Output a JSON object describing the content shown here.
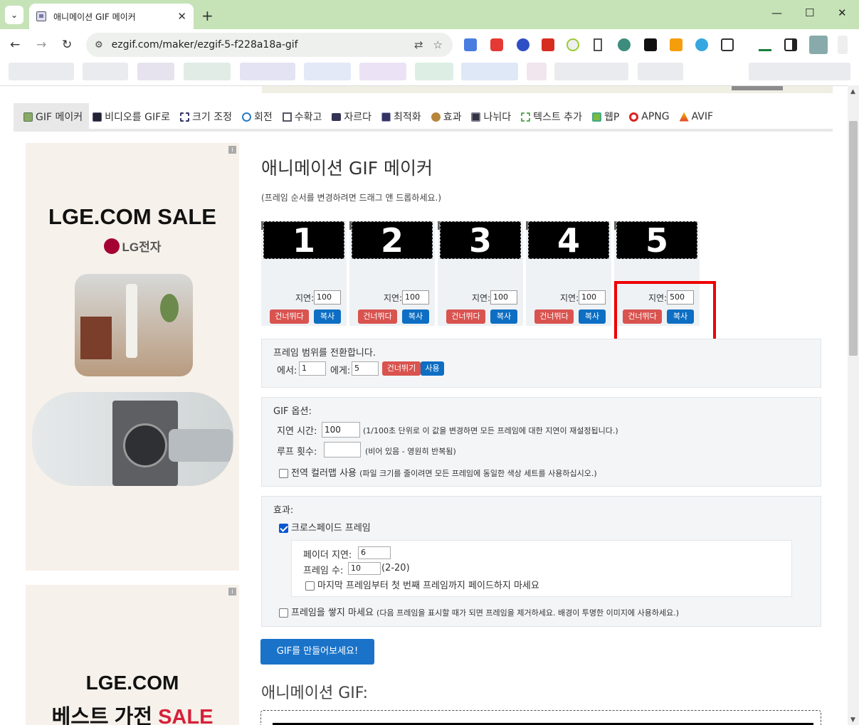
{
  "browser": {
    "tab_title": "애니메이션 GIF 메이커",
    "url": "ezgif.com/maker/ezgif-5-f228a18a-gif",
    "window_controls": [
      "minimize-icon",
      "maximize-icon",
      "close-icon"
    ]
  },
  "menu": {
    "items": [
      {
        "label": "GIF 메이커",
        "icon": "gif-maker-icon"
      },
      {
        "label": "비디오를 GIF로",
        "icon": "video-icon"
      },
      {
        "label": "크기 조정",
        "icon": "resize-icon"
      },
      {
        "label": "회전",
        "icon": "rotate-icon"
      },
      {
        "label": "수확고",
        "icon": "crop-icon"
      },
      {
        "label": "자르다",
        "icon": "cut-icon"
      },
      {
        "label": "최적화",
        "icon": "optimize-icon"
      },
      {
        "label": "효과",
        "icon": "effects-icon"
      },
      {
        "label": "나뉘다",
        "icon": "split-icon"
      },
      {
        "label": "텍스트 추가",
        "icon": "text-icon"
      },
      {
        "label": "웹P",
        "icon": "webp-icon"
      },
      {
        "label": "APNG",
        "icon": "apng-icon"
      },
      {
        "label": "AVIF",
        "icon": "avif-icon"
      }
    ]
  },
  "ads": {
    "top": {
      "title": "LGE.COM SALE",
      "brand": "LG전자"
    },
    "bottom": {
      "line1": "LGE.COM",
      "line2_a": "베스트 가전",
      "line2_b": "SALE"
    }
  },
  "main": {
    "title": "애니메이션 GIF 메이커",
    "hint": "(프레임 순서를 변경하려면 드래그 앤 드롭하세요.)",
    "delay_label": "지연:",
    "skip_label": "건너뛰다",
    "copy_label": "복사",
    "frames": [
      {
        "index": "1",
        "digit": "1",
        "delay": "100"
      },
      {
        "index": "2",
        "digit": "2",
        "delay": "100"
      },
      {
        "index": "삼",
        "digit": "3",
        "delay": "100"
      },
      {
        "index": "4",
        "digit": "4",
        "delay": "100"
      },
      {
        "index": "5",
        "digit": "5",
        "delay": "500"
      }
    ]
  },
  "range": {
    "title": "프레임 범위를 전환합니다.",
    "from_label": "에서:",
    "from_value": "1",
    "to_label": "에게:",
    "to_value": "5",
    "skip_label": "건너뛰기",
    "use_label": "사용"
  },
  "gif_options": {
    "title": "GIF 옵션:",
    "delay_label": "지연 시간:",
    "delay_value": "100",
    "delay_note": "(1/100초 단위로 이 값을 변경하면 모든 프레임에 대한 지연이 재설정됩니다.)",
    "loop_label": "루프 횟수:",
    "loop_value": "",
    "loop_note": "(비어 있음 - 영원히 반복됨)",
    "global_label": "전역 컬러맵 사용",
    "global_note": "(파일 크기를 줄이려면 모든 프레임에 동일한 색상 세트를 사용하십시오.)"
  },
  "effects": {
    "title": "효과:",
    "crossfade_label": "크로스페이드 프레임",
    "crossfade_checked": true,
    "fader_delay_label": "페이더 지연:",
    "fader_delay_value": "6",
    "frame_count_label": "프레임 수:",
    "frame_count_value": "10",
    "frame_count_range": "(2-20)",
    "no_fade_label": "마지막 프레임부터 첫 번째 프레임까지 페이드하지 마세요",
    "no_stack_label": "프레임을 쌓지 마세요",
    "no_stack_note": "(다음 프레임을 표시할 때가 되면 프레임을 제거하세요. 배경이 투명한 이미지에 사용하세요.)"
  },
  "make_button": "GIF를 만들어보세요!",
  "output_title": "애니메이션 GIF:"
}
